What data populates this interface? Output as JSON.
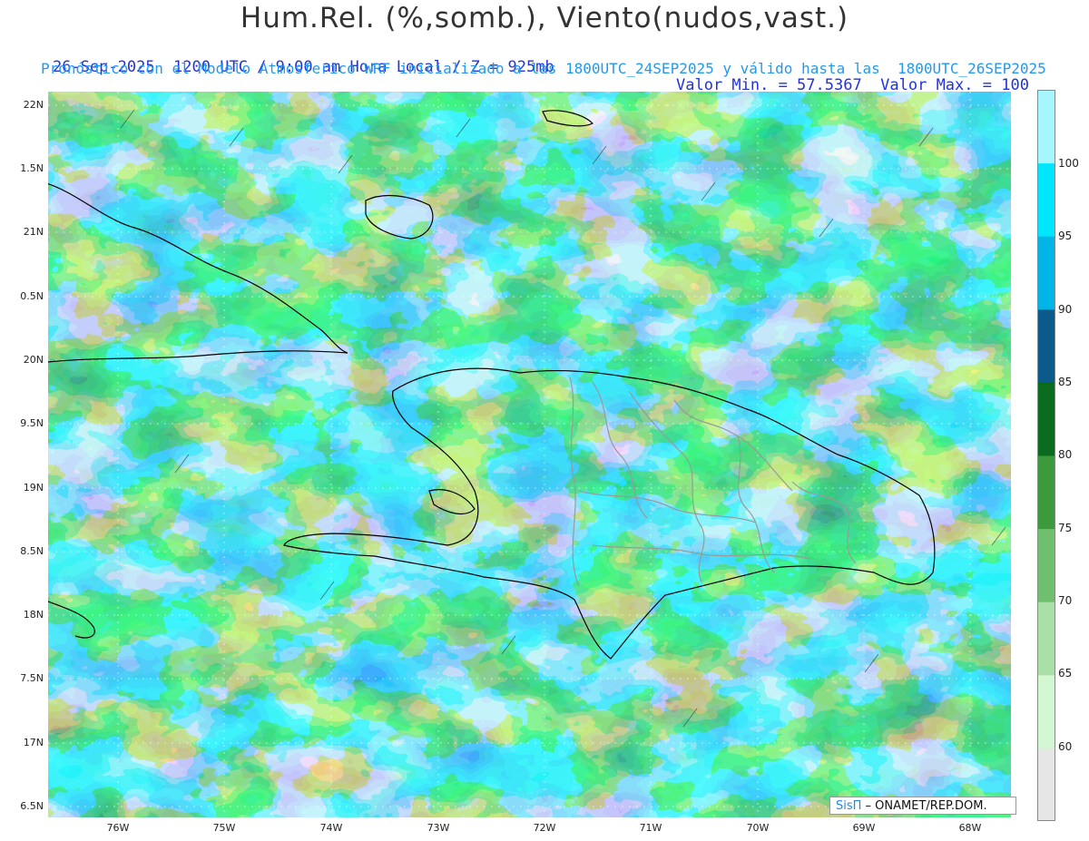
{
  "header": {
    "title": "Hum.Rel. (%,somb.), Viento(nudos,vast.)",
    "line1_left": "26-Sep-2025  1200 UTC / 9:00 am Hora Local / Z = 925mb",
    "line1_right": "Valor Min. = 57.5367  Valor Max. = 100",
    "line2": "Pronóstico con el Modelo Atmosferico WRF inicializado a las 1800UTC_24SEP2025 y válido hasta las  1800UTC_26SEP2025"
  },
  "axes": {
    "lat_labels": [
      "22N",
      "1.5N",
      "21N",
      "0.5N",
      "20N",
      "9.5N",
      "19N",
      "8.5N",
      "18N",
      "7.5N",
      "17N",
      "6.5N"
    ],
    "lon_labels": [
      "76W",
      "75W",
      "74W",
      "73W",
      "72W",
      "71W",
      "70W",
      "69W",
      "68W"
    ]
  },
  "colorbar": {
    "labels": [
      "100",
      "95",
      "90",
      "85",
      "80",
      "75",
      "70",
      "65",
      "60"
    ],
    "colors": [
      "#e6e6e6",
      "#d2f5d2",
      "#a8e0a8",
      "#6fbf6f",
      "#3c9a3c",
      "#0a6a1e",
      "#0a5a8a",
      "#00b4e6",
      "#00e6ff",
      "#a6f5ff"
    ]
  },
  "credit": {
    "logo": "SisΠ",
    "text": " – ONAMET/REP.DOM."
  }
}
